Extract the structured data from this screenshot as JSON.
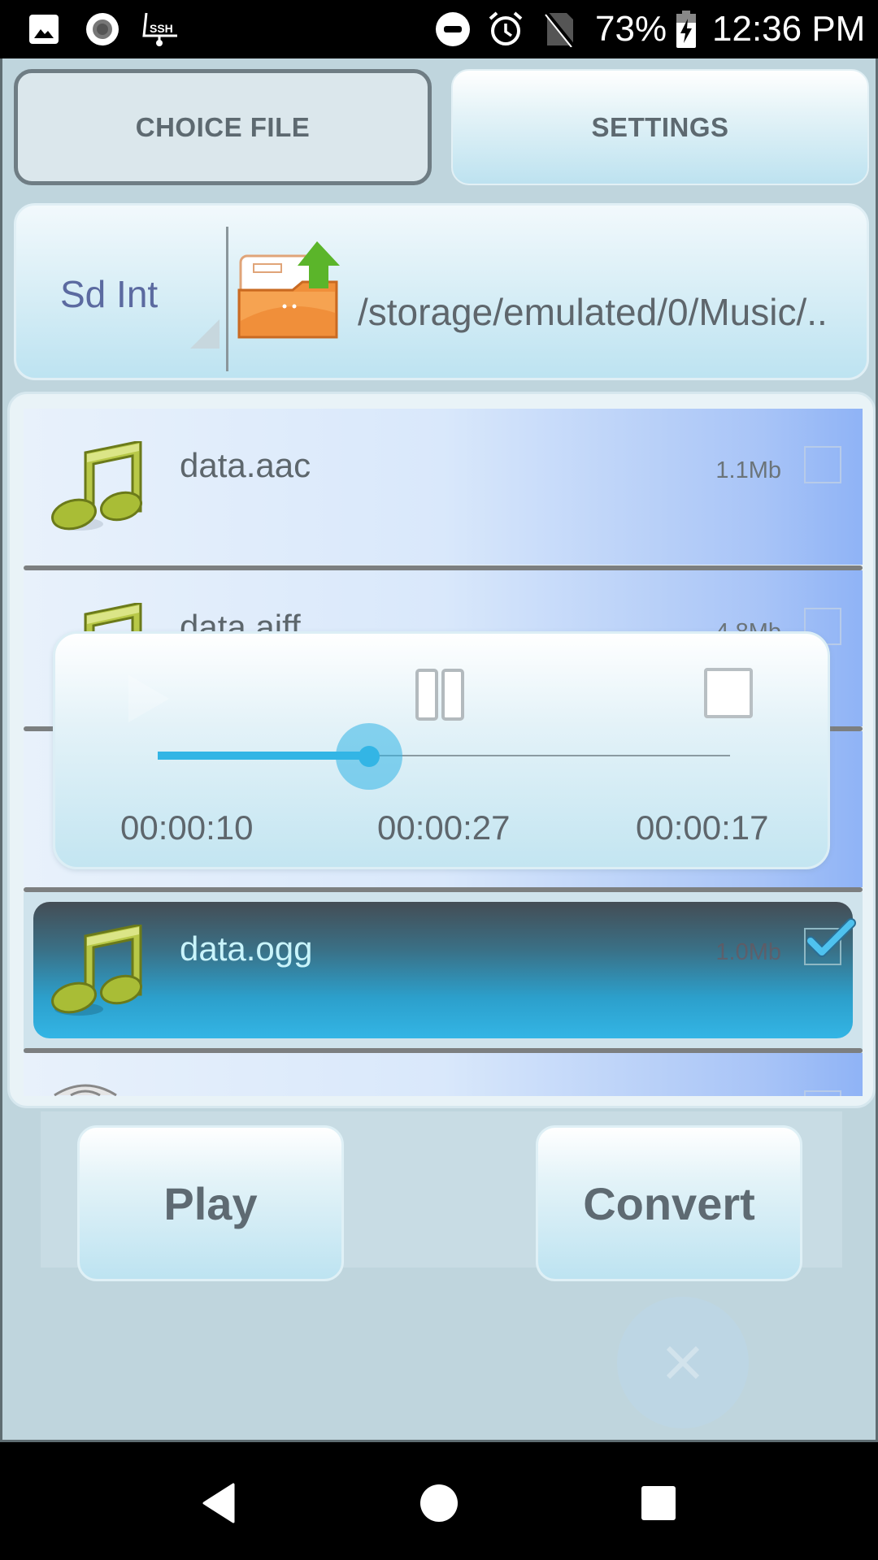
{
  "status_bar": {
    "left_icons": [
      "image-notification-icon",
      "record-icon",
      "ssh-icon"
    ],
    "ssh_label": "SSH",
    "right_icons": [
      "do-not-disturb-icon",
      "alarm-icon",
      "no-sim-icon",
      "battery-charging-icon"
    ],
    "battery": "73%",
    "time": "12:36 PM"
  },
  "toolbar": {
    "choice_file": "CHOICE FILE",
    "settings": "SETTINGS"
  },
  "path_bar": {
    "storage": "Sd Int",
    "path": "/storage/emulated/0/Music/.."
  },
  "files": [
    {
      "name": "data.aac",
      "size": "1.1Mb",
      "checked": false,
      "icon": "music-note-icon"
    },
    {
      "name": "data.aiff",
      "size": "4.8Mb",
      "checked": false,
      "icon": "music-note-icon"
    },
    {
      "name": "data.ogg",
      "size": "1.0Mb",
      "checked": true,
      "selected": true,
      "icon": "music-note-icon"
    }
  ],
  "player": {
    "elapsed": "00:00:10",
    "total": "00:00:27",
    "remaining": "00:00:17",
    "progress_percent": 37
  },
  "actions": {
    "play": "Play",
    "convert": "Convert"
  },
  "colors": {
    "accent": "#33b5e5",
    "app_bg": "#bfd5dd",
    "text": "#5e666c"
  }
}
